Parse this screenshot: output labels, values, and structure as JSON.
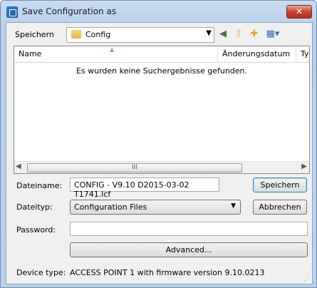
{
  "window": {
    "title": "Save Configuration as",
    "close_label": "✕"
  },
  "lookin": {
    "label": "Speichern",
    "folder": "Config"
  },
  "list": {
    "columns": [
      "Name",
      "Änderungsdatum",
      "Ty"
    ],
    "empty_message": "Es wurden keine Suchergebnisse gefunden.",
    "scroll_thumb": "III"
  },
  "filename": {
    "label": "Dateiname:",
    "value": "CONFIG - V9.10 D2015-03-02 T1741.lcf"
  },
  "filetype": {
    "label": "Dateityp:",
    "value": "Configuration Files"
  },
  "password": {
    "label": "Password:",
    "value": ""
  },
  "buttons": {
    "save": "Speichern",
    "cancel": "Abbrechen",
    "advanced": "Advanced..."
  },
  "device": {
    "label": "Device type:",
    "value": "ACCESS POINT 1  with firmware version 9.10.0213"
  },
  "icons": [
    "back-icon",
    "up-folder-icon",
    "new-folder-icon",
    "view-menu-icon"
  ]
}
